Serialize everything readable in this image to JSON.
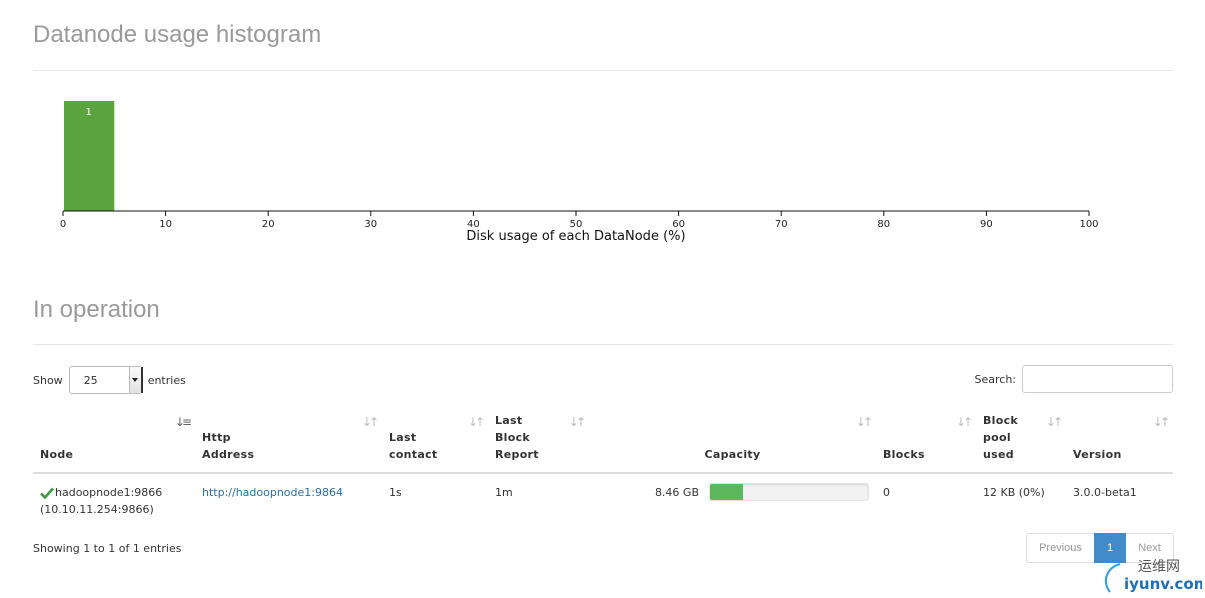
{
  "histogram": {
    "title": "Datanode usage histogram",
    "chart_data": {
      "type": "bar",
      "title": "",
      "xlabel": "Disk usage of each DataNode (%)",
      "ylabel": "",
      "xlim": [
        0,
        100
      ],
      "xticks": [
        0,
        10,
        20,
        30,
        40,
        50,
        60,
        70,
        80,
        90,
        100
      ],
      "bins": [
        [
          0,
          5
        ]
      ],
      "values": [
        1
      ],
      "ylim": [
        0,
        1
      ],
      "grid": false,
      "bar_color": "#5aa33f"
    }
  },
  "operation": {
    "title": "In operation",
    "show_label": "Show",
    "page_length": "25",
    "entries_label": "entries",
    "search_label": "Search:",
    "search_value": "",
    "columns": [
      {
        "lines": [
          "Node"
        ]
      },
      {
        "lines": [
          "Http",
          "Address"
        ]
      },
      {
        "lines": [
          "Last",
          "contact"
        ]
      },
      {
        "lines": [
          "Last",
          "Block",
          "Report"
        ]
      },
      {
        "lines": [
          "Capacity"
        ]
      },
      {
        "lines": [
          "Blocks"
        ]
      },
      {
        "lines": [
          "Block",
          "pool",
          "used"
        ]
      },
      {
        "lines": [
          "Version"
        ]
      }
    ],
    "rows": [
      {
        "node": "hadoopnode1:9866",
        "node_ip": "(10.10.11.254:9866)",
        "http_address": "http://hadoopnode1:9864",
        "last_contact": "1s",
        "last_block_report": "1m",
        "capacity": "8.46 GB",
        "capacity_used_fraction": 0.21,
        "blocks": "0",
        "block_pool_used": "12 KB (0%)",
        "version": "3.0.0-beta1"
      }
    ],
    "info": "Showing 1 to 1 of 1 entries",
    "pagination": {
      "previous": "Previous",
      "current": "1",
      "next": "Next"
    }
  },
  "colors": {
    "accent": "#428bca",
    "success": "#5cb85c",
    "histogram_bar": "#5aa33f",
    "link": "#2a6ea5"
  },
  "watermark": {
    "text_cn": "运维网",
    "text_url": "iyunv.com"
  }
}
